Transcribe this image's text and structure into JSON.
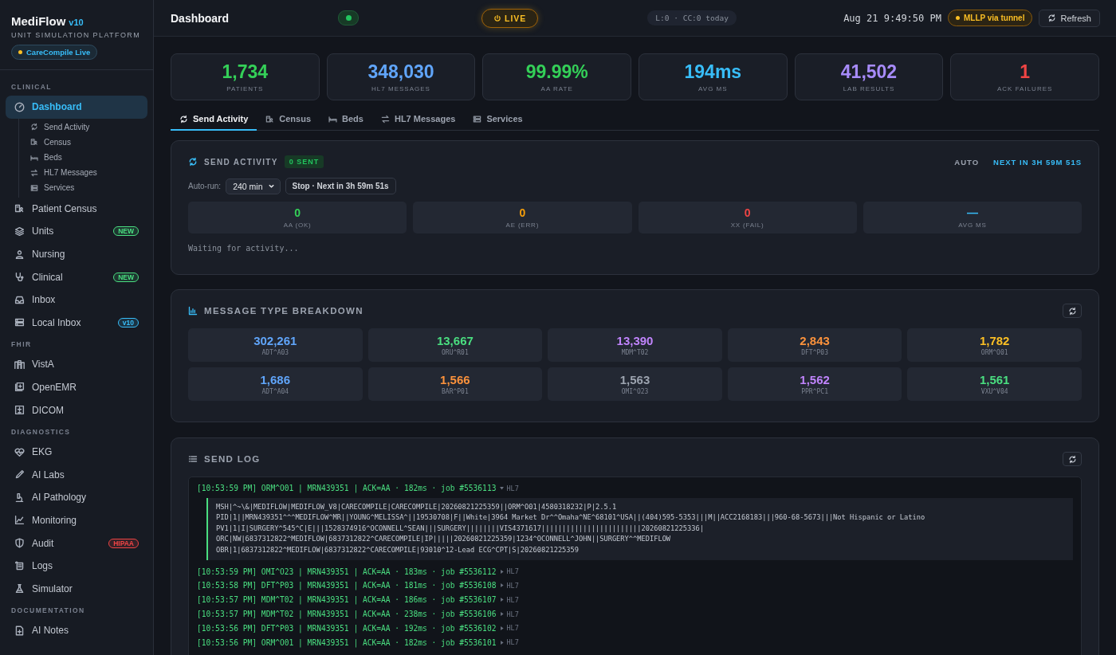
{
  "brand": {
    "name": "MediFlow",
    "version": "v10",
    "subtitle": "UNIT SIMULATION PLATFORM",
    "status": "CareCompile Live"
  },
  "sidebar": {
    "sections": [
      {
        "title": "CLINICAL",
        "items": [
          {
            "label": "Dashboard",
            "selected": true,
            "children": [
              {
                "label": "Send Activity",
                "selected": false
              },
              {
                "label": "Census",
                "selected": false
              },
              {
                "label": "Beds",
                "selected": false
              },
              {
                "label": "HL7 Messages",
                "selected": false
              },
              {
                "label": "Services",
                "selected": false
              }
            ]
          },
          {
            "label": "Patient Census",
            "selected": false
          },
          {
            "label": "Units",
            "selected": false,
            "badge": {
              "text": "NEW",
              "color": "#4ade80"
            }
          },
          {
            "label": "Nursing",
            "selected": false
          },
          {
            "label": "Clinical",
            "selected": false,
            "badge": {
              "text": "NEW",
              "color": "#4ade80"
            }
          },
          {
            "label": "Inbox",
            "selected": false
          },
          {
            "label": "Local Inbox",
            "selected": false,
            "badge": {
              "text": "v10",
              "color": "#38bdf8"
            }
          }
        ]
      },
      {
        "title": "FHIR",
        "items": [
          {
            "label": "VistA",
            "selected": false
          },
          {
            "label": "OpenEMR",
            "selected": false
          },
          {
            "label": "DICOM",
            "selected": false
          }
        ]
      },
      {
        "title": "DIAGNOSTICS",
        "items": [
          {
            "label": "EKG",
            "selected": false
          },
          {
            "label": "AI Labs",
            "selected": false
          },
          {
            "label": "AI Pathology",
            "selected": false
          },
          {
            "label": "Monitoring",
            "selected": false
          },
          {
            "label": "Audit",
            "selected": false,
            "badge": {
              "text": "HIPAA",
              "color": "#ef4444"
            }
          },
          {
            "label": "Logs",
            "selected": false
          },
          {
            "label": "Simulator",
            "selected": false
          }
        ]
      },
      {
        "title": "DOCUMENTATION",
        "items": [
          {
            "label": "AI Notes",
            "selected": false
          }
        ]
      }
    ]
  },
  "header": {
    "title": "Dashboard",
    "live_button": "LIVE",
    "counters": "L:0 · CC:0 today",
    "clock": "Aug 21 9:49:50 PM",
    "tunnel": "MLLP via tunnel",
    "refresh": "Refresh"
  },
  "stats": [
    {
      "value": "1,734",
      "label": "PATIENTS",
      "color": "#34d058"
    },
    {
      "value": "348,030",
      "label": "HL7 MESSAGES",
      "color": "#60a5fa"
    },
    {
      "value": "99.99%",
      "label": "AA RATE",
      "color": "#34d058"
    },
    {
      "value": "194ms",
      "label": "AVG MS",
      "color": "#38bdf8"
    },
    {
      "value": "41,502",
      "label": "LAB RESULTS",
      "color": "#a78bfa"
    },
    {
      "value": "1",
      "label": "ACK FAILURES",
      "color": "#ef4444"
    }
  ],
  "tabs": [
    {
      "label": "Send Activity",
      "selected": true
    },
    {
      "label": "Census",
      "selected": false
    },
    {
      "label": "Beds",
      "selected": false
    },
    {
      "label": "HL7 Messages",
      "selected": false
    },
    {
      "label": "Services",
      "selected": false
    }
  ],
  "send_activity": {
    "title": "SEND ACTIVITY",
    "sent_badge": "0 SENT",
    "auto": "AUTO",
    "next": "NEXT IN 3H 59M 51S",
    "autorun_label": "Auto-run:",
    "interval": "240 min",
    "stop_button": "Stop · Next in 3h 59m 51s",
    "counters": [
      {
        "value": "0",
        "label": "AA (OK)",
        "color": "#34d058"
      },
      {
        "value": "0",
        "label": "AE (ERR)",
        "color": "#f59e0b"
      },
      {
        "value": "0",
        "label": "XX (FAIL)",
        "color": "#ef4444"
      },
      {
        "value": "—",
        "label": "AVG MS",
        "color": "#38bdf8"
      }
    ],
    "status": "Waiting for activity..."
  },
  "breakdown": {
    "title": "MESSAGE TYPE BREAKDOWN",
    "items": [
      {
        "value": "302,261",
        "label": "ADT^A03",
        "color": "#60a5fa"
      },
      {
        "value": "13,667",
        "label": "ORU^R01",
        "color": "#4ade80"
      },
      {
        "value": "13,390",
        "label": "MDM^T02",
        "color": "#c084fc"
      },
      {
        "value": "2,843",
        "label": "DFT^P03",
        "color": "#fb923c"
      },
      {
        "value": "1,782",
        "label": "ORM^O01",
        "color": "#fbbf24"
      },
      {
        "value": "1,686",
        "label": "ADT^A04",
        "color": "#60a5fa"
      },
      {
        "value": "1,566",
        "label": "BAR^P01",
        "color": "#fb923c"
      },
      {
        "value": "1,563",
        "label": "OMI^O23",
        "color": "#9ca3af"
      },
      {
        "value": "1,562",
        "label": "PPR^PC1",
        "color": "#c084fc"
      },
      {
        "value": "1,561",
        "label": "VXU^V04",
        "color": "#4ade80"
      }
    ]
  },
  "send_log": {
    "title": "SEND LOG",
    "entries": [
      {
        "text": "[10:53:59 PM] ORM^O01 | MRN439351 | ACK=AA · 182ms · job #5536113",
        "tag": "HL7",
        "expanded": true,
        "segments": [
          "MSH|^~\\&|MEDIFLOW|MEDIFLOW_V8|CARECOMPILE|CARECOMPILE|20260821225359||ORM^O01|4580318232|P|2.5.1",
          "PID|1||MRN439351^^^MEDIFLOW^MR||YOUNG^MELISSA^||19530708|F||White|3964 Market Dr^^Omaha^NE^68101^USA||(404)595-5353|||M||ACC2168183|||960-68-5673|||Not Hispanic or Latino",
          "PV1|1|I|SURGERY^545^C|E|||1528374916^OCONNELL^SEAN|||SURGERY||||||||VIS4371617||||||||||||||||||||||||20260821225336|",
          "ORC|NW|6837312822^MEDIFLOW|6837312822^CARECOMPILE|IP|||||20260821225359|1234^OCONNELL^JOHN||SURGERY^^MEDIFLOW",
          "OBR|1|6837312822^MEDIFLOW|6837312822^CARECOMPILE|93010^12-Lead ECG^CPT|S|20260821225359"
        ]
      },
      {
        "text": "[10:53:59 PM] OMI^O23 | MRN439351 | ACK=AA · 183ms · job #5536112",
        "tag": "HL7",
        "expanded": false
      },
      {
        "text": "[10:53:58 PM] DFT^P03 | MRN439351 | ACK=AA · 181ms · job #5536108",
        "tag": "HL7",
        "expanded": false
      },
      {
        "text": "[10:53:57 PM] MDM^T02 | MRN439351 | ACK=AA · 186ms · job #5536107",
        "tag": "HL7",
        "expanded": false
      },
      {
        "text": "[10:53:57 PM] MDM^T02 | MRN439351 | ACK=AA · 238ms · job #5536106",
        "tag": "HL7",
        "expanded": false
      },
      {
        "text": "[10:53:56 PM] DFT^P03 | MRN439351 | ACK=AA · 192ms · job #5536102",
        "tag": "HL7",
        "expanded": false
      },
      {
        "text": "[10:53:56 PM] ORM^O01 | MRN439351 | ACK=AA · 182ms · job #5536101",
        "tag": "HL7",
        "expanded": false
      }
    ]
  }
}
